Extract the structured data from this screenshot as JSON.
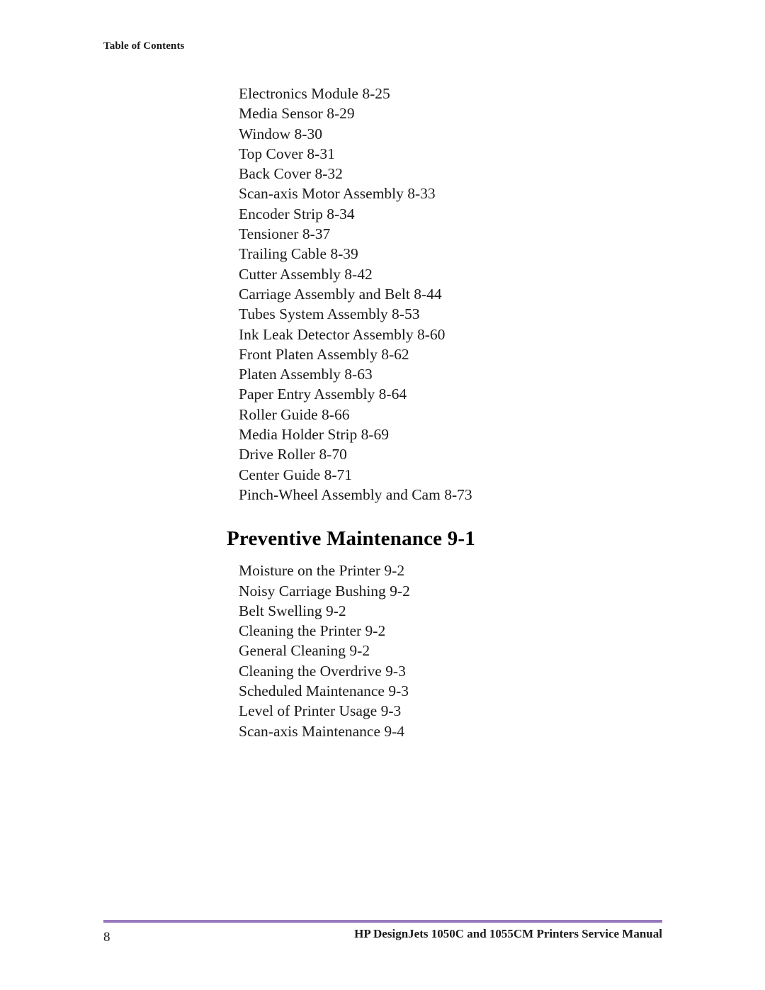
{
  "running_header": "Table of Contents",
  "toc": {
    "entries_before_heading": [
      "Electronics Module 8-25",
      "Media Sensor 8-29",
      "Window 8-30",
      "Top Cover 8-31",
      "Back Cover 8-32",
      "Scan-axis Motor Assembly 8-33",
      "Encoder Strip 8-34",
      "Tensioner 8-37",
      "Trailing Cable 8-39",
      "Cutter Assembly 8-42",
      "Carriage Assembly and Belt 8-44",
      "Tubes System Assembly 8-53",
      "Ink Leak Detector Assembly 8-60",
      "Front Platen Assembly 8-62",
      "Platen Assembly 8-63",
      "Paper Entry Assembly 8-64",
      "Roller Guide 8-66",
      "Media Holder Strip 8-69",
      "Drive Roller 8-70",
      "Center Guide 8-71",
      "Pinch-Wheel Assembly and Cam 8-73"
    ],
    "section_heading": "Preventive Maintenance 9-1",
    "entries_after_heading": [
      "Moisture on the Printer 9-2",
      "Noisy Carriage Bushing 9-2",
      "Belt Swelling 9-2",
      "Cleaning the Printer 9-2",
      "General Cleaning 9-2",
      "Cleaning the Overdrive 9-3",
      "Scheduled Maintenance 9-3",
      "Level of Printer Usage 9-3",
      "Scan-axis Maintenance 9-4"
    ]
  },
  "footer": {
    "page_number": "8",
    "manual_title": "HP DesignJets 1050C and 1055CM Printers Service Manual",
    "rule_color": "#9779be"
  }
}
